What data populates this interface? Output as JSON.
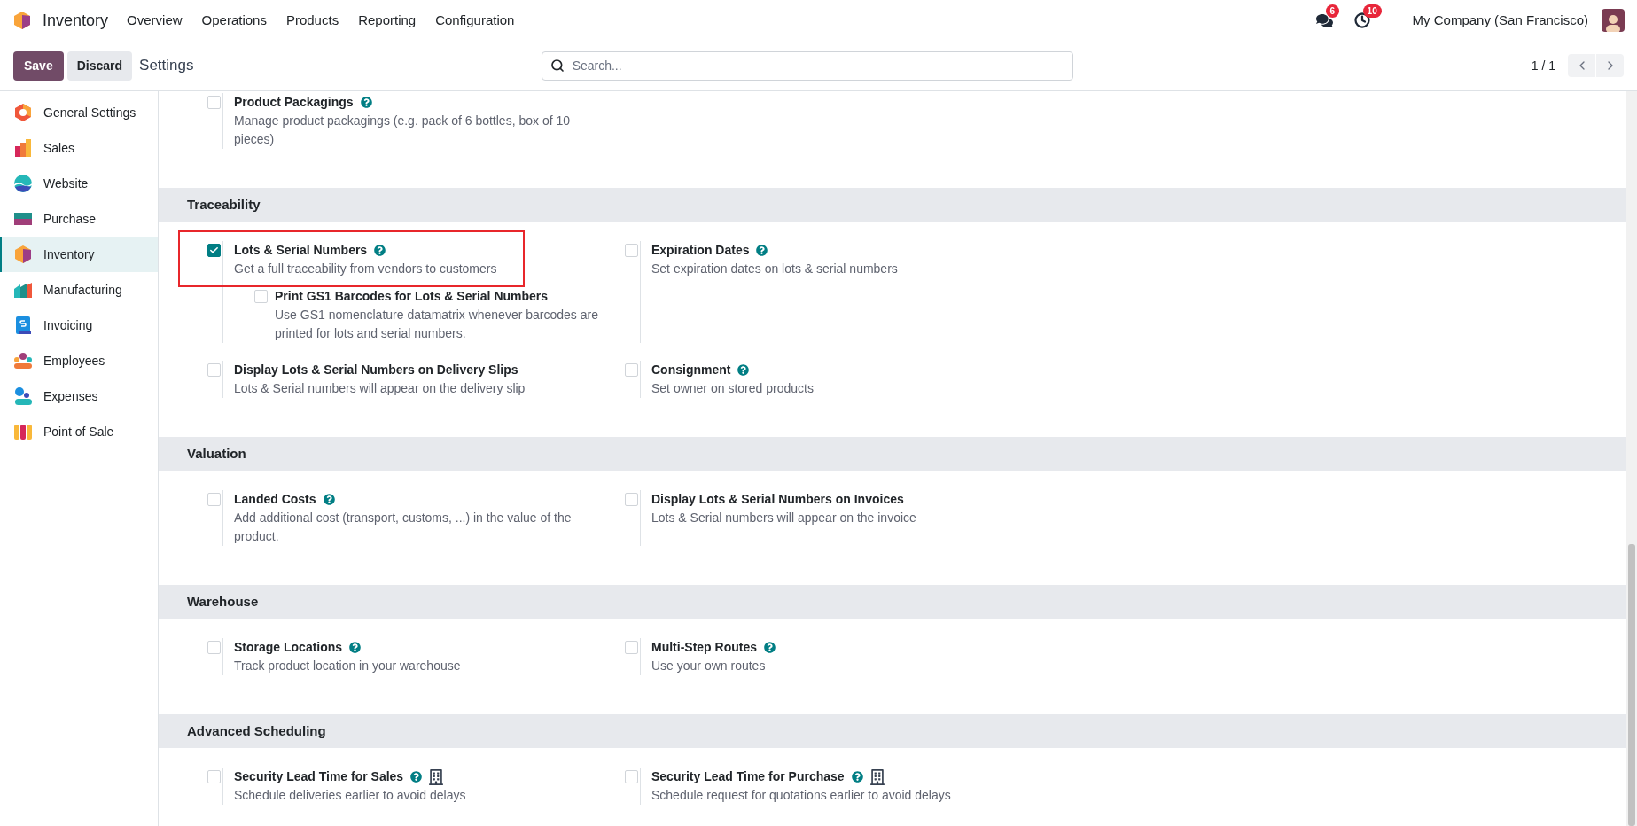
{
  "app": {
    "name": "Inventory",
    "menu": [
      "Overview",
      "Operations",
      "Products",
      "Reporting",
      "Configuration"
    ]
  },
  "systray": {
    "messages_badge": "6",
    "activities_badge": "10",
    "company": "My Company (San Francisco)"
  },
  "control_panel": {
    "save": "Save",
    "discard": "Discard",
    "breadcrumb": "Settings",
    "search": {
      "placeholder": "Search..."
    },
    "pager": "1 / 1"
  },
  "sidebar": {
    "items": [
      {
        "label": "General Settings",
        "selected": false
      },
      {
        "label": "Sales",
        "selected": false
      },
      {
        "label": "Website",
        "selected": false
      },
      {
        "label": "Purchase",
        "selected": false
      },
      {
        "label": "Inventory",
        "selected": true
      },
      {
        "label": "Manufacturing",
        "selected": false
      },
      {
        "label": "Invoicing",
        "selected": false
      },
      {
        "label": "Employees",
        "selected": false
      },
      {
        "label": "Expenses",
        "selected": false
      },
      {
        "label": "Point of Sale",
        "selected": false
      }
    ]
  },
  "sections": [
    {
      "rows": [
        [
          {
            "title": "Product Packagings",
            "description": "Manage product packagings (e.g. pack of 6 bottles, box of 10 pieces)",
            "help": true,
            "checked": false
          }
        ]
      ]
    },
    {
      "title": "Traceability",
      "rows": [
        [
          {
            "title": "Lots & Serial Numbers",
            "description": "Get a full traceability from vendors to customers",
            "help": true,
            "checked": true,
            "highlighted": true,
            "children": [
              {
                "title": "Print GS1 Barcodes for Lots & Serial Numbers",
                "description": "Use GS1 nomenclature datamatrix whenever barcodes are printed for lots and serial numbers.",
                "help": false,
                "checked": false
              }
            ]
          },
          {
            "title": "Expiration Dates",
            "description": "Set expiration dates on lots & serial numbers",
            "help": true,
            "checked": false
          }
        ],
        [
          {
            "title": "Display Lots & Serial Numbers on Delivery Slips",
            "description": "Lots & Serial numbers will appear on the delivery slip",
            "help": false,
            "checked": false
          },
          {
            "title": "Consignment",
            "description": "Set owner on stored products",
            "help": true,
            "checked": false
          }
        ]
      ]
    },
    {
      "title": "Valuation",
      "rows": [
        [
          {
            "title": "Landed Costs",
            "description": "Add additional cost (transport, customs, ...) in the value of the product.",
            "help": true,
            "checked": false
          },
          {
            "title": "Display Lots & Serial Numbers on Invoices",
            "description": "Lots & Serial numbers will appear on the invoice",
            "help": false,
            "checked": false
          }
        ]
      ]
    },
    {
      "title": "Warehouse",
      "rows": [
        [
          {
            "title": "Storage Locations",
            "description": "Track product location in your warehouse",
            "help": true,
            "checked": false
          },
          {
            "title": "Multi-Step Routes",
            "description": "Use your own routes",
            "help": true,
            "checked": false
          }
        ]
      ]
    },
    {
      "title": "Advanced Scheduling",
      "rows": [
        [
          {
            "title": "Security Lead Time for Sales",
            "description": "Schedule deliveries earlier to avoid delays",
            "help": true,
            "checked": false,
            "company_specific": true
          },
          {
            "title": "Security Lead Time for Purchase",
            "description": "Schedule request for quotations earlier to avoid delays",
            "help": true,
            "checked": false,
            "company_specific": true
          }
        ]
      ]
    }
  ]
}
